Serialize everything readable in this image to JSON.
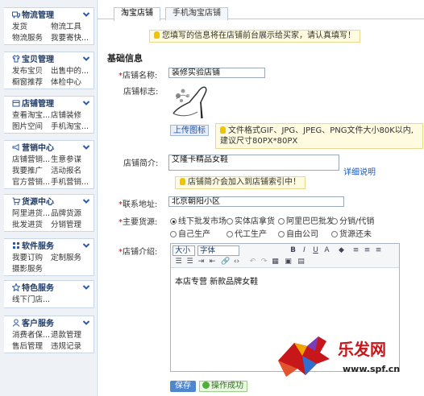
{
  "sidebar": {
    "sections": [
      {
        "title": "物流管理",
        "icon": "truck-icon",
        "links": [
          [
            "发货",
            "物流工具"
          ],
          [
            "物流服务",
            "我要寄快..."
          ]
        ]
      },
      {
        "title": "宝贝管理",
        "icon": "shirt-icon",
        "links": [
          [
            "发布宝贝",
            "出售中的..."
          ],
          [
            "橱窗推荐",
            "体检中心"
          ]
        ]
      },
      {
        "title": "店铺管理",
        "icon": "shop-icon",
        "links": [
          [
            "查看淘宝...",
            "店铺装修"
          ],
          [
            "图片空间",
            "手机淘宝..."
          ]
        ]
      },
      {
        "title": "营销中心",
        "icon": "megaphone-icon",
        "links": [
          [
            "店铺营销...",
            "生意参谋"
          ],
          [
            "我要推广",
            "活动报名"
          ],
          [
            "官方营销...",
            "手机营销..."
          ]
        ]
      },
      {
        "title": "货源中心",
        "icon": "cart-icon",
        "links": [
          [
            "阿里进货...",
            "品牌货源"
          ],
          [
            "批发进货",
            "分销管理"
          ]
        ]
      },
      {
        "title": "软件服务",
        "icon": "grid-icon",
        "links": [
          [
            "我要订购",
            "定制服务"
          ],
          [
            "摄影服务",
            ""
          ]
        ]
      },
      {
        "title": "特色服务",
        "icon": "star-icon",
        "links": [
          [
            "线下门店...",
            ""
          ]
        ]
      },
      {
        "title": "客户服务",
        "icon": "person-icon",
        "links": [
          [
            "消费者保...",
            "退款管理"
          ],
          [
            "售后管理",
            "违规记录"
          ]
        ]
      }
    ]
  },
  "tabs": [
    "淘宝店铺",
    "手机淘宝店铺"
  ],
  "top_notice": "您填写的信息将在店铺前台展示给买家，请认真填写！",
  "form": {
    "section_title": "基础信息",
    "shop_name": {
      "label": "店铺名称:",
      "value": "装修实验店铺"
    },
    "shop_logo": {
      "label": "店铺标志:",
      "upload_label": "上传图标",
      "hint_line1": "文件格式GIF、JPG、JPEG、PNG文件大小80K以内,",
      "hint_line2": "建议尺寸80PX*80PX"
    },
    "shop_intro": {
      "label": "店铺简介:",
      "value": "艾隆卡精品女鞋",
      "detail_link": "详细说明",
      "hint": "店铺简介会加入到店铺索引中！"
    },
    "address": {
      "label": "联系地址:",
      "value": "北京朝阳小区"
    },
    "supply": {
      "label": "主要货源:",
      "options": [
        "线下批发市场",
        "实体店拿货",
        "阿里巴巴批发",
        "分销/代销",
        "自己生产",
        "代工生产",
        "自由公司",
        "货源还未"
      ],
      "selected": 0
    },
    "intro": {
      "label": "店铺介绍:",
      "size_select": "大小",
      "font_select": "字体",
      "content": "本店专营  新款品牌女鞋"
    },
    "save_label": "保存",
    "success_message": "操作成功"
  },
  "watermark": {
    "text": "乐发网",
    "url": "www.spf.cn"
  },
  "colors": {
    "required": "#dd0000",
    "link": "#1a56b8",
    "save_button": "#4e86d0",
    "notice_bg": "#fffbe0"
  }
}
